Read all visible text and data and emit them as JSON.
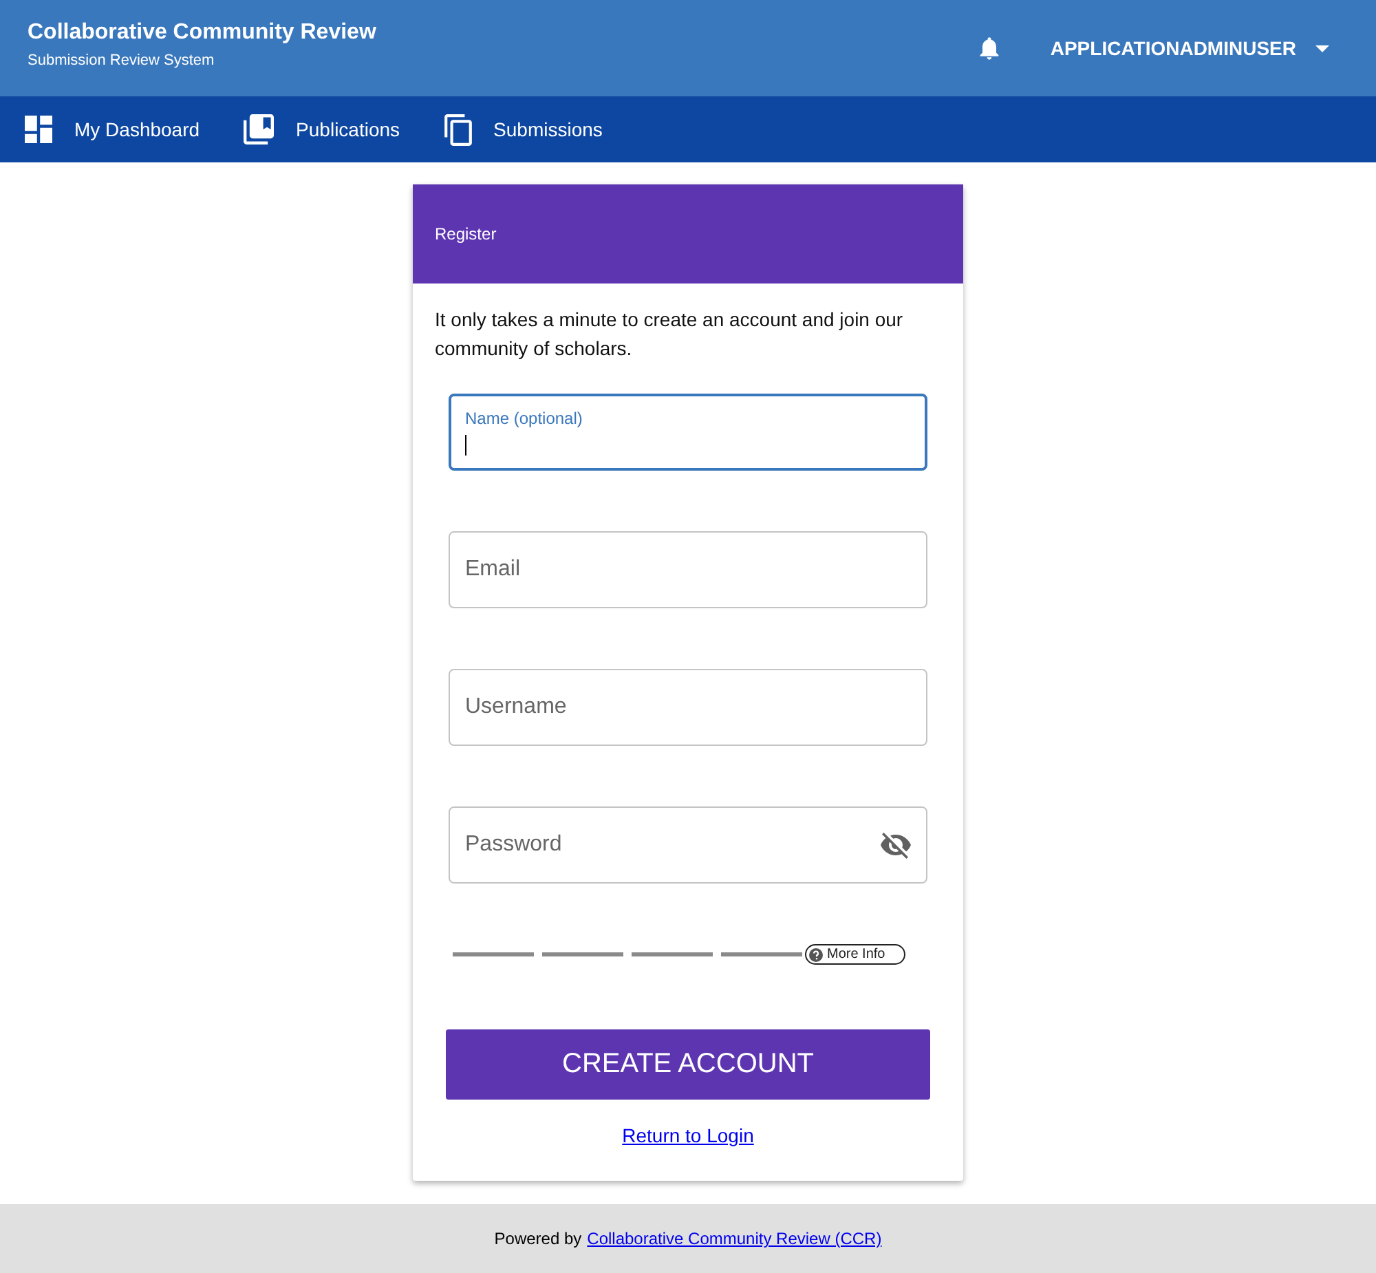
{
  "header": {
    "title": "Collaborative Community Review",
    "subtitle": "Submission Review System",
    "user": "APPLICATIONADMINUSER"
  },
  "nav": [
    {
      "label": "My Dashboard"
    },
    {
      "label": "Publications"
    },
    {
      "label": "Submissions"
    }
  ],
  "card": {
    "title": "Register",
    "intro": "It only takes a minute to create an account and join our community of scholars.",
    "fields": [
      {
        "label": "Name (optional)",
        "focused": true,
        "kind": "text"
      },
      {
        "label": "Email",
        "focused": false,
        "kind": "text"
      },
      {
        "label": "Username",
        "focused": false,
        "kind": "text"
      },
      {
        "label": "Password",
        "focused": false,
        "kind": "password"
      }
    ],
    "strength": {
      "more_info": "More Info"
    },
    "submit": "CREATE ACCOUNT",
    "link": "Return to Login"
  },
  "footer": {
    "text": "Powered by",
    "link": "Collaborative Community Review (CCR)"
  }
}
